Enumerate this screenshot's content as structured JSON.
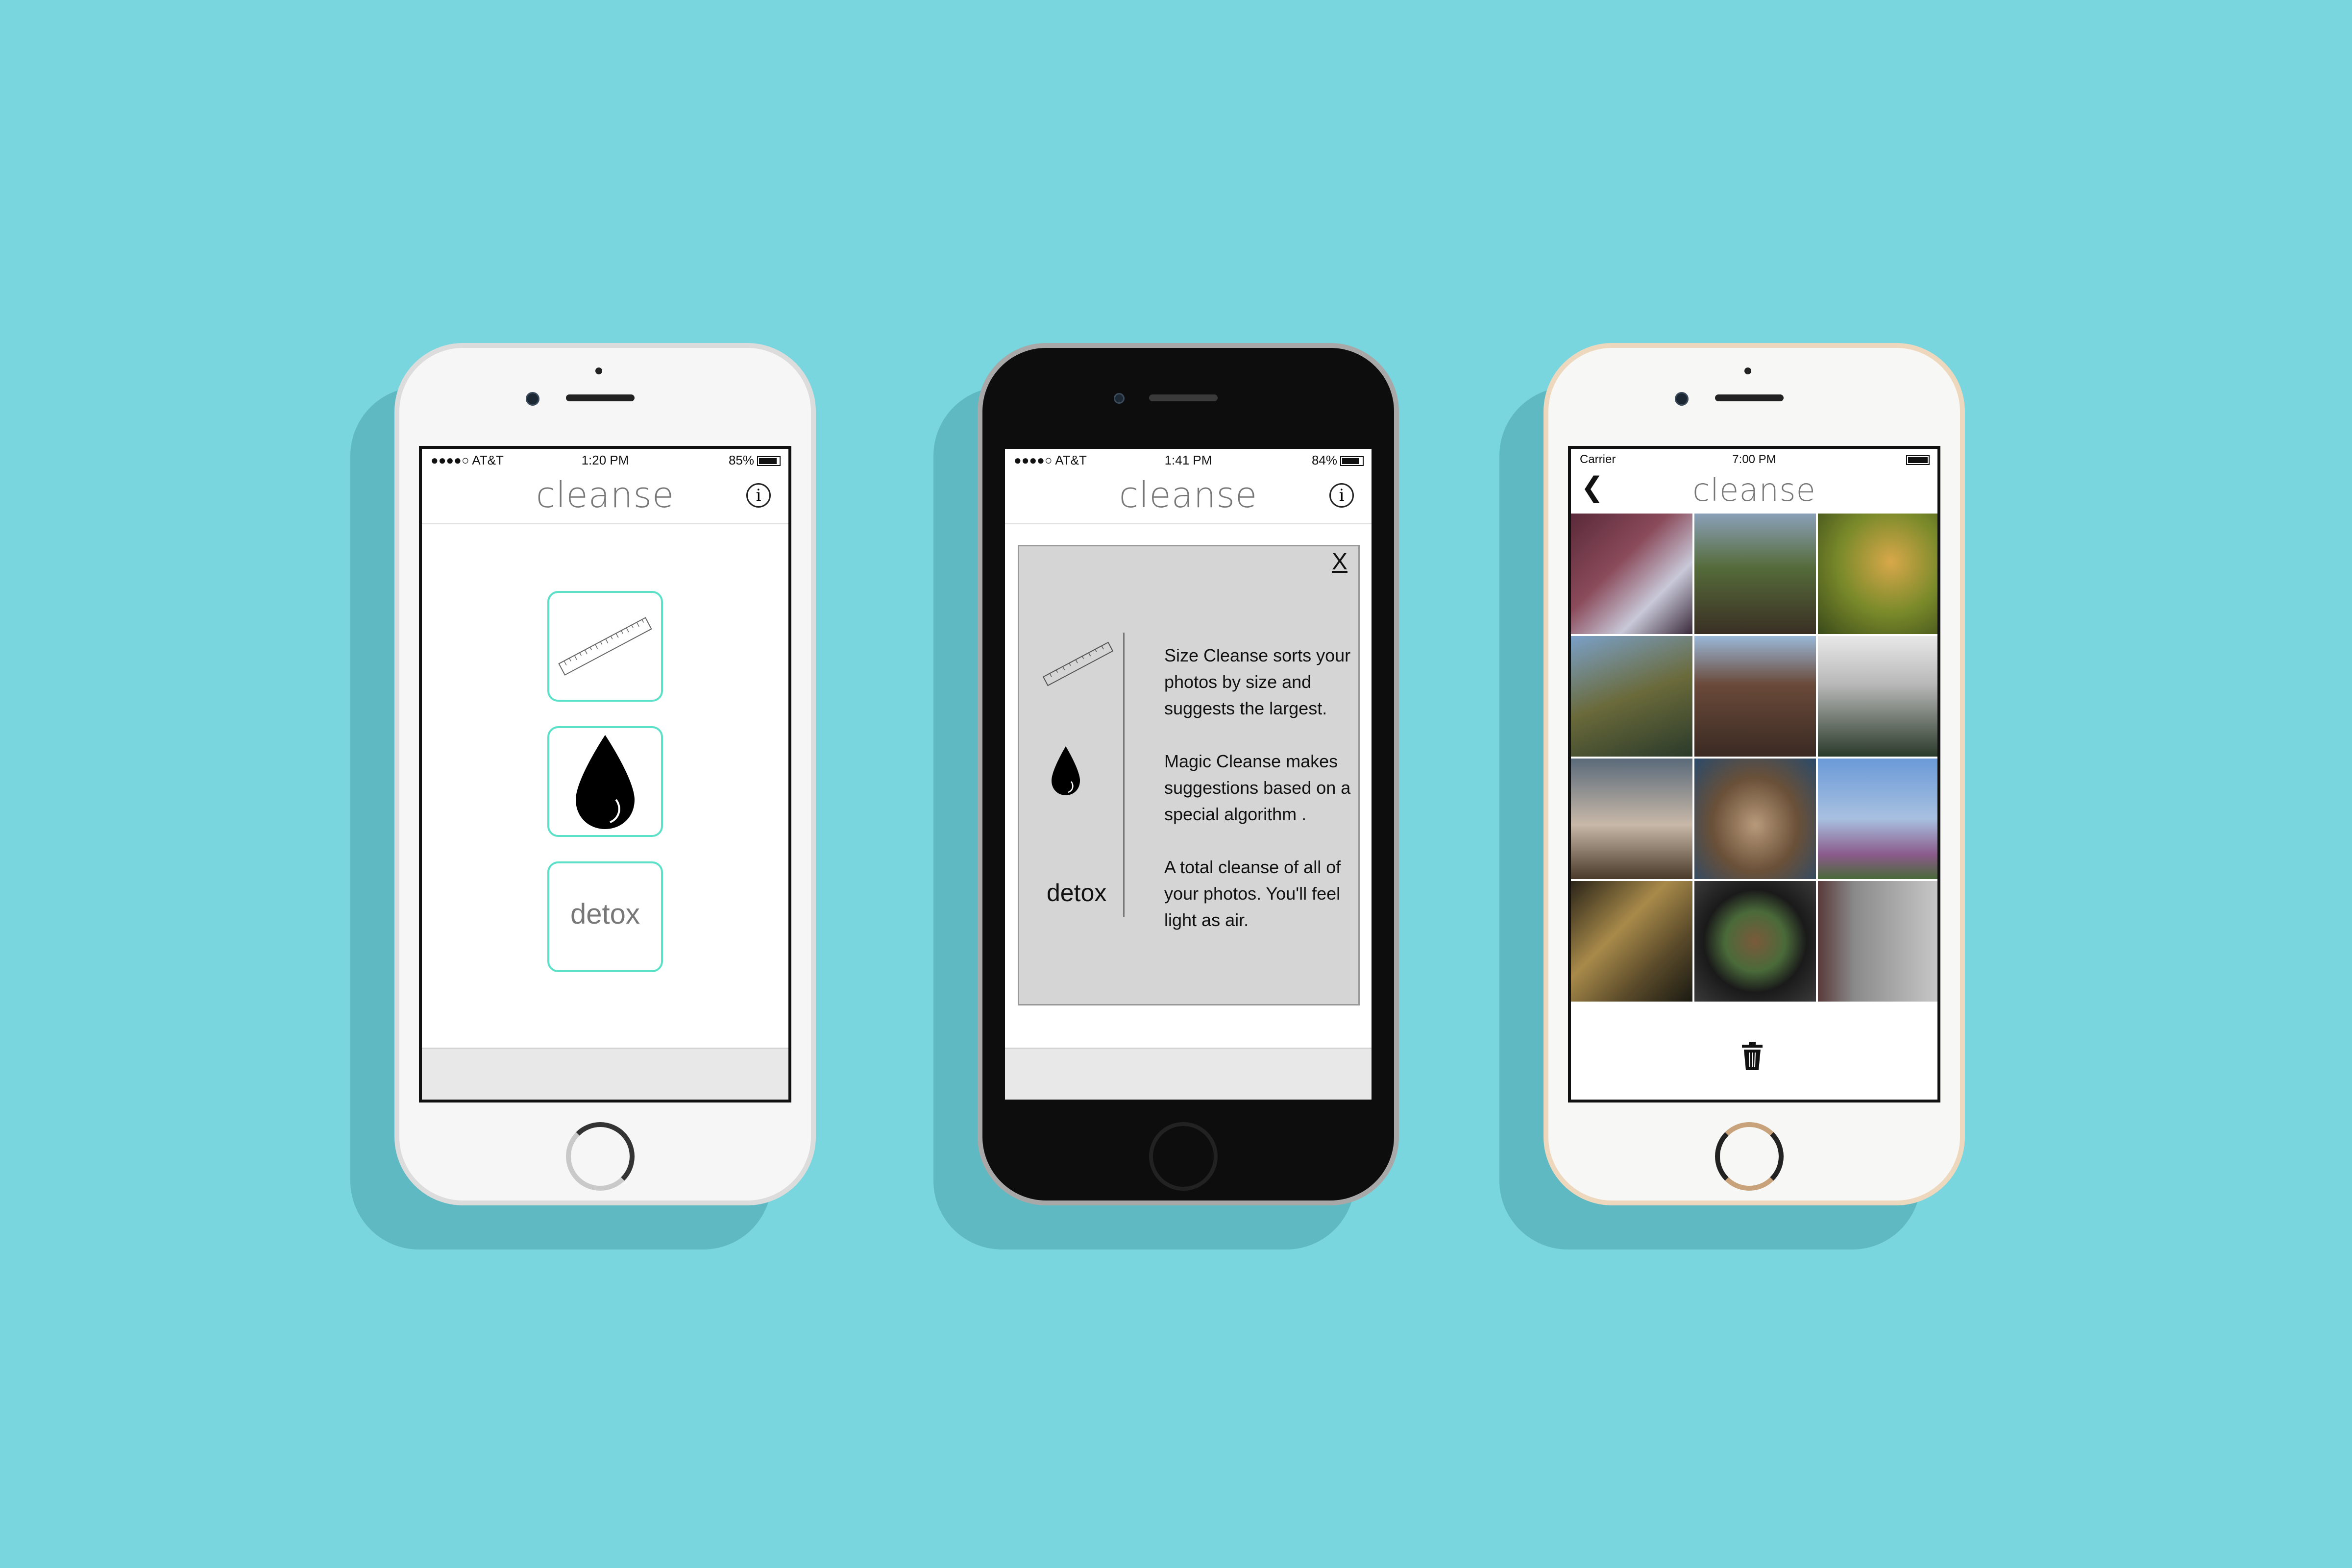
{
  "phones": [
    {
      "status": {
        "carrier": "●●●●○ AT&T ",
        "time": "1:20 PM",
        "battery": "85%"
      },
      "app_title": "cleanse",
      "tiles": [
        {
          "icon": "ruler-icon"
        },
        {
          "icon": "drop-icon"
        },
        {
          "label": "detox"
        }
      ]
    },
    {
      "status": {
        "carrier": "●●●●○ AT&T ",
        "time": "1:41 PM",
        "battery": "84%"
      },
      "app_title": "cleanse",
      "modal": {
        "close_label": "X",
        "items": [
          {
            "icon": "ruler-icon",
            "text": "Size Cleanse sorts your photos by size and suggests the largest."
          },
          {
            "icon": "drop-icon",
            "text": "Magic Cleanse makes suggestions based on a special algorithm ."
          },
          {
            "label": "detox",
            "text": "A total cleanse of all of your photos. You'll feel light as air."
          }
        ]
      }
    },
    {
      "status": {
        "carrier": "Carrier ",
        "time": "7:00 PM",
        "battery": ""
      },
      "app_title": "cleanse",
      "photos": [
        "tree-canopy-photo",
        "trees-street-photo",
        "squirrel-photo",
        "skyscraper-photo",
        "building-photo",
        "foggy-forest-photo",
        "cafe-table-photo",
        "bread-photo",
        "wildflowers-photo",
        "baked-goods-photo",
        "food-bowl-photo",
        "keypad-photo"
      ]
    }
  ],
  "colors": {
    "background": "#79d6de",
    "accent": "#5ce0c8",
    "modal": "#d5d5d5"
  }
}
